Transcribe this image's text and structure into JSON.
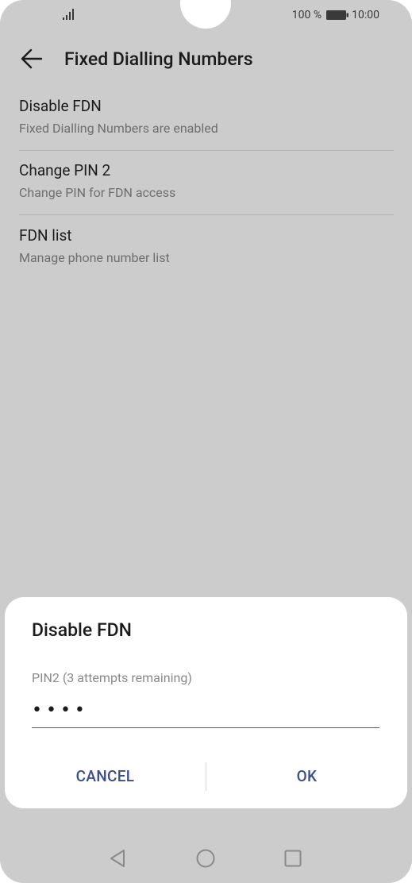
{
  "status_bar": {
    "battery_percent": "100 %",
    "time": "10:00"
  },
  "header": {
    "title": "Fixed Dialling Numbers"
  },
  "list": {
    "items": [
      {
        "title": "Disable FDN",
        "subtitle": "Fixed Dialling Numbers are enabled"
      },
      {
        "title": "Change PIN 2",
        "subtitle": "Change PIN for FDN access"
      },
      {
        "title": "FDN list",
        "subtitle": "Manage phone number list"
      }
    ]
  },
  "dialog": {
    "title": "Disable FDN",
    "pin_label": "PIN2 (3 attempts remaining)",
    "pin_value": "••••",
    "cancel_label": "CANCEL",
    "ok_label": "OK"
  },
  "colors": {
    "background_dim": "#cccccc",
    "dialog_background": "#ffffff",
    "accent": "#3a4d8f"
  },
  "icons": {
    "signal": "signal-icon",
    "battery": "battery-icon",
    "back": "arrow-left-icon",
    "nav_back": "triangle-back-icon",
    "nav_home": "circle-home-icon",
    "nav_recent": "square-recent-icon"
  }
}
